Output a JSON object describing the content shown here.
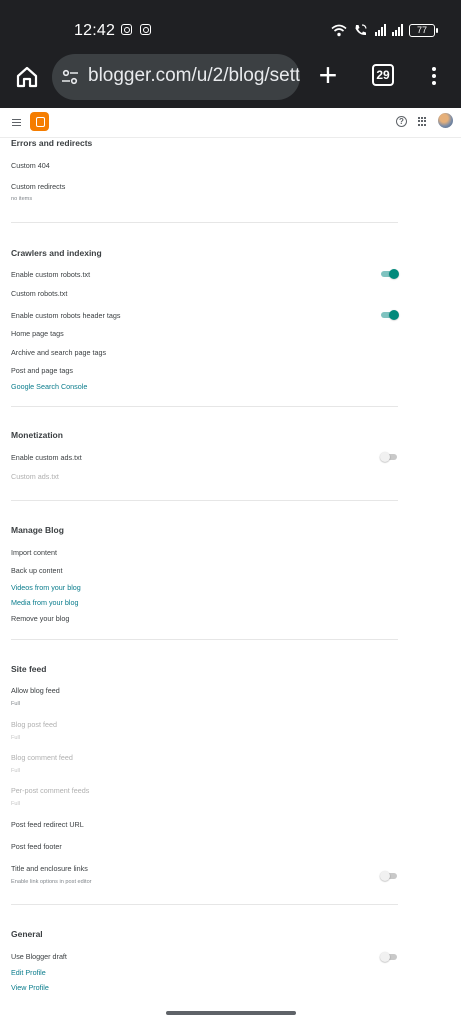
{
  "status_bar": {
    "time": "12:42",
    "battery": "77"
  },
  "browser": {
    "url": "blogger.com/u/2/blog/sett",
    "tab_count": "29"
  },
  "sections": {
    "errors": {
      "title": "Errors and redirects",
      "custom_404": "Custom 404",
      "custom_redirects": "Custom redirects",
      "custom_redirects_sub": "no items"
    },
    "crawlers": {
      "title": "Crawlers and indexing",
      "enable_robots": "Enable custom robots.txt",
      "enable_robots_on": true,
      "custom_robots": "Custom robots.txt",
      "enable_header_tags": "Enable custom robots header tags",
      "enable_header_tags_on": true,
      "home_tags": "Home page tags",
      "archive_tags": "Archive and search page tags",
      "post_tags": "Post and page tags",
      "search_console": "Google Search Console"
    },
    "monetization": {
      "title": "Monetization",
      "enable_ads": "Enable custom ads.txt",
      "enable_ads_on": false,
      "custom_ads": "Custom ads.txt"
    },
    "manage": {
      "title": "Manage Blog",
      "import": "Import content",
      "backup": "Back up content",
      "videos": "Videos from your blog",
      "media": "Media from your blog",
      "remove": "Remove your blog"
    },
    "feed": {
      "title": "Site feed",
      "allow": "Allow blog feed",
      "allow_value": "Full",
      "post_feed": "Blog post feed",
      "post_feed_value": "Full",
      "comment_feed": "Blog comment feed",
      "comment_feed_value": "Full",
      "per_post": "Per-post comment feeds",
      "per_post_value": "Full",
      "redirect": "Post feed redirect URL",
      "footer": "Post feed footer",
      "title_links": "Title and enclosure links",
      "title_links_sub": "Enable link options in post editor",
      "title_links_on": false
    },
    "general": {
      "title": "General",
      "draft": "Use Blogger draft",
      "draft_on": false,
      "edit_profile": "Edit Profile",
      "view_profile": "View Profile"
    }
  },
  "colors": {
    "accent": "#00897b",
    "link": "#0a7c8c",
    "blogger_orange": "#f57d00",
    "toolbar": "#1f2023"
  }
}
